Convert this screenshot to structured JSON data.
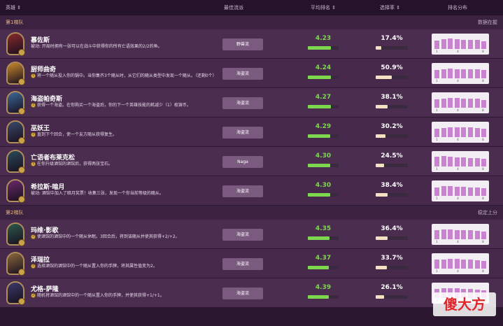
{
  "header": {
    "col_hero": "英雄 ⇕",
    "col_synergy": "最佳流派",
    "col_avg_place": "平均排名 ⇕",
    "col_pick_rate": "选择率 ⇕",
    "col_distribution": "排名分布"
  },
  "tiers": [
    {
      "name": "第1梯队",
      "right_label": "数据在握",
      "heroes": [
        {
          "name": "慕佐斯",
          "desc": "被动: 开局时拥有一张可以在战斗中获得你的所有亡语效果的2/2的鱼。",
          "coin": "",
          "synergy": "野兽流",
          "avg": "4.23",
          "avg_frac": 0.76,
          "pick": "17.4%",
          "pick_frac": 0.17,
          "dist": [
            0.55,
            0.62,
            0.66,
            0.62,
            0.6,
            0.58,
            0.57,
            0.5
          ],
          "color": "#8a2a2a"
        },
        {
          "name": "厨师曲奇",
          "desc": "将一个随从投入你的锅中。当你集齐3个随从时，从它们的随从类型中发现一个随从。（还剩0个）",
          "coin": "1",
          "synergy": "海盗流",
          "avg": "4.24",
          "avg_frac": 0.75,
          "pick": "50.9%",
          "pick_frac": 0.51,
          "dist": [
            0.55,
            0.6,
            0.62,
            0.6,
            0.6,
            0.6,
            0.58,
            0.55
          ],
          "color": "#c88a2a"
        },
        {
          "name": "海盗帕奇斯",
          "desc": "获得一个海盗。在你购买一个海盗后，你的下一个英雄技能的耗减少（1）枚铸币。",
          "coin": "1",
          "synergy": "海盗流",
          "avg": "4.27",
          "avg_frac": 0.74,
          "pick": "38.1%",
          "pick_frac": 0.38,
          "dist": [
            0.55,
            0.6,
            0.62,
            0.62,
            0.6,
            0.6,
            0.58,
            0.52
          ],
          "color": "#3a6a9a"
        },
        {
          "name": "巫妖王",
          "desc": "直到下个回合，使一个友方随从获得复生。",
          "coin": "1",
          "synergy": "海盗流",
          "avg": "4.29",
          "avg_frac": 0.73,
          "pick": "30.2%",
          "pick_frac": 0.3,
          "dist": [
            0.55,
            0.6,
            0.62,
            0.64,
            0.62,
            0.62,
            0.6,
            0.55
          ],
          "color": "#3a4a6a"
        },
        {
          "name": "亡语者布莱克松",
          "desc": "在你升级酒馆的酒馆后，获得两张宝石。",
          "coin": "1",
          "synergy": "Naga",
          "avg": "4.30",
          "avg_frac": 0.72,
          "pick": "24.5%",
          "pick_frac": 0.25,
          "dist": [
            0.65,
            0.7,
            0.62,
            0.6,
            0.58,
            0.55,
            0.55,
            0.5
          ],
          "color": "#2a4a5a"
        },
        {
          "name": "希拉斯·暗月",
          "desc": "被动: 酒馆中加入了暗月奖票！收集三张，发现一个你当前等级的随从。",
          "coin": "",
          "synergy": "海盗流",
          "avg": "4.30",
          "avg_frac": 0.72,
          "pick": "38.4%",
          "pick_frac": 0.38,
          "dist": [
            0.55,
            0.62,
            0.62,
            0.6,
            0.58,
            0.55,
            0.55,
            0.52
          ],
          "color": "#6a2a6a"
        }
      ]
    },
    {
      "name": "第2梯队",
      "right_label": "稳定上分",
      "heroes": [
        {
          "name": "玛维·影歌",
          "desc": "使酒馆的酒馆中的一个随从休眠。3回合后，将到该随从并使其获得+2/+2。",
          "coin": "2",
          "synergy": "海盗流",
          "avg": "4.35",
          "avg_frac": 0.7,
          "pick": "36.4%",
          "pick_frac": 0.36,
          "dist": [
            0.6,
            0.62,
            0.62,
            0.6,
            0.6,
            0.58,
            0.56,
            0.5
          ],
          "color": "#2a5a4a"
        },
        {
          "name": "泽瑞拉",
          "desc": "选择酒馆的酒馆中的一个随从置入你的手牌，将其属性值变为2。",
          "coin": "2",
          "synergy": "海盗流",
          "avg": "4.37",
          "avg_frac": 0.69,
          "pick": "33.7%",
          "pick_frac": 0.34,
          "dist": [
            0.58,
            0.6,
            0.62,
            0.62,
            0.6,
            0.58,
            0.55,
            0.5
          ],
          "color": "#8a6a3a"
        },
        {
          "name": "尤格-萨隆",
          "desc": "随机将酒馆的酒馆中的一个随从置入你的手牌，并使其获得+1/+1。",
          "coin": "2",
          "synergy": "海盗流",
          "avg": "4.39",
          "avg_frac": 0.68,
          "pick": "26.1%",
          "pick_frac": 0.26,
          "dist": [
            0.6,
            0.62,
            0.62,
            0.62,
            0.6,
            0.58,
            0.55,
            0.5
          ],
          "color": "#3a3a6a"
        }
      ]
    }
  ],
  "dist_ticks": [
    "1",
    "4",
    "8"
  ],
  "watermark": "傻大方"
}
